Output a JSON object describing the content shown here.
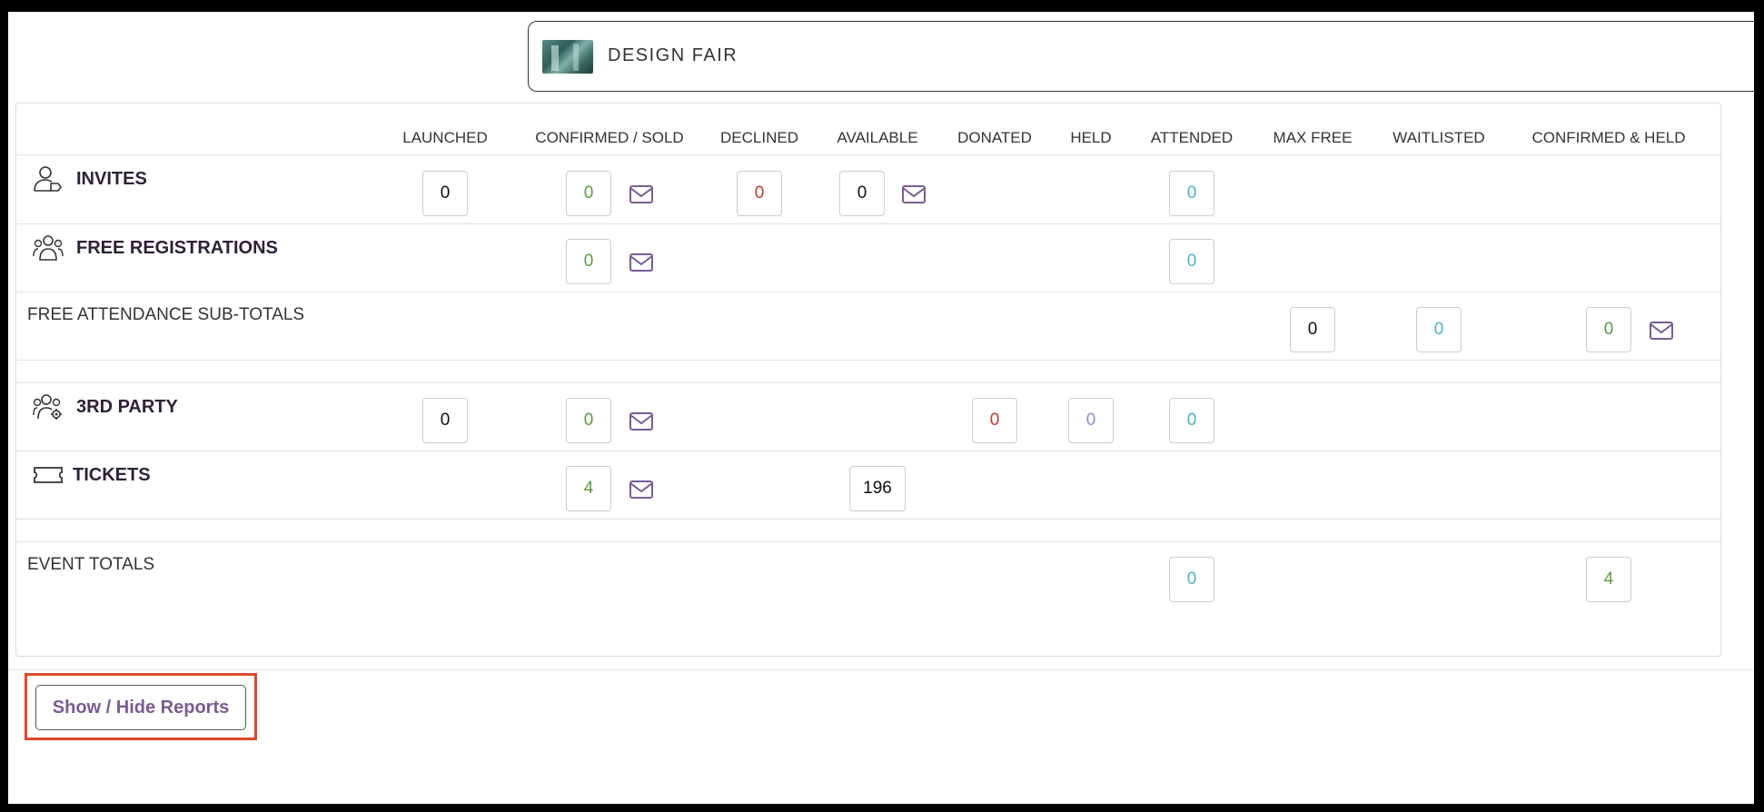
{
  "event": {
    "title": "DESIGN FAIR"
  },
  "columns": {
    "launched": "LAUNCHED",
    "confirmed_sold": "CONFIRMED / SOLD",
    "declined": "DECLINED",
    "available": "AVAILABLE",
    "donated": "DONATED",
    "held": "HELD",
    "attended": "ATTENDED",
    "max_free": "MAX FREE",
    "waitlisted": "WAITLISTED",
    "confirmed_held": "CONFIRMED & HELD"
  },
  "rows": {
    "invites": {
      "label": "INVITES",
      "icon": "user-tag-icon",
      "launched": "0",
      "confirmed": "0",
      "declined": "0",
      "available": "0",
      "attended": "0"
    },
    "free_registrations": {
      "label": "FREE REGISTRATIONS",
      "icon": "users-group-icon",
      "confirmed": "0",
      "attended": "0"
    },
    "free_subtotals": {
      "label": "FREE ATTENDANCE SUB-TOTALS",
      "max_free": "0",
      "waitlisted": "0",
      "confirmed_held": "0"
    },
    "third_party": {
      "label": "3RD PARTY",
      "icon": "users-gear-icon",
      "launched": "0",
      "confirmed": "0",
      "donated": "0",
      "held": "0",
      "attended": "0"
    },
    "tickets": {
      "label": "TICKETS",
      "icon": "ticket-icon",
      "confirmed": "4",
      "available": "196"
    },
    "event_totals": {
      "label": "EVENT TOTALS",
      "attended": "0",
      "confirmed_held": "4"
    }
  },
  "actions": {
    "show_hide_reports": "Show / Hide Reports"
  },
  "colors": {
    "confirmed": "#5a9e3e",
    "declined": "#c23a2a",
    "attended": "#4fb3c0",
    "held": "#8a8fd8",
    "mail_icon": "#7a5b93",
    "highlight": "#e0472b"
  }
}
